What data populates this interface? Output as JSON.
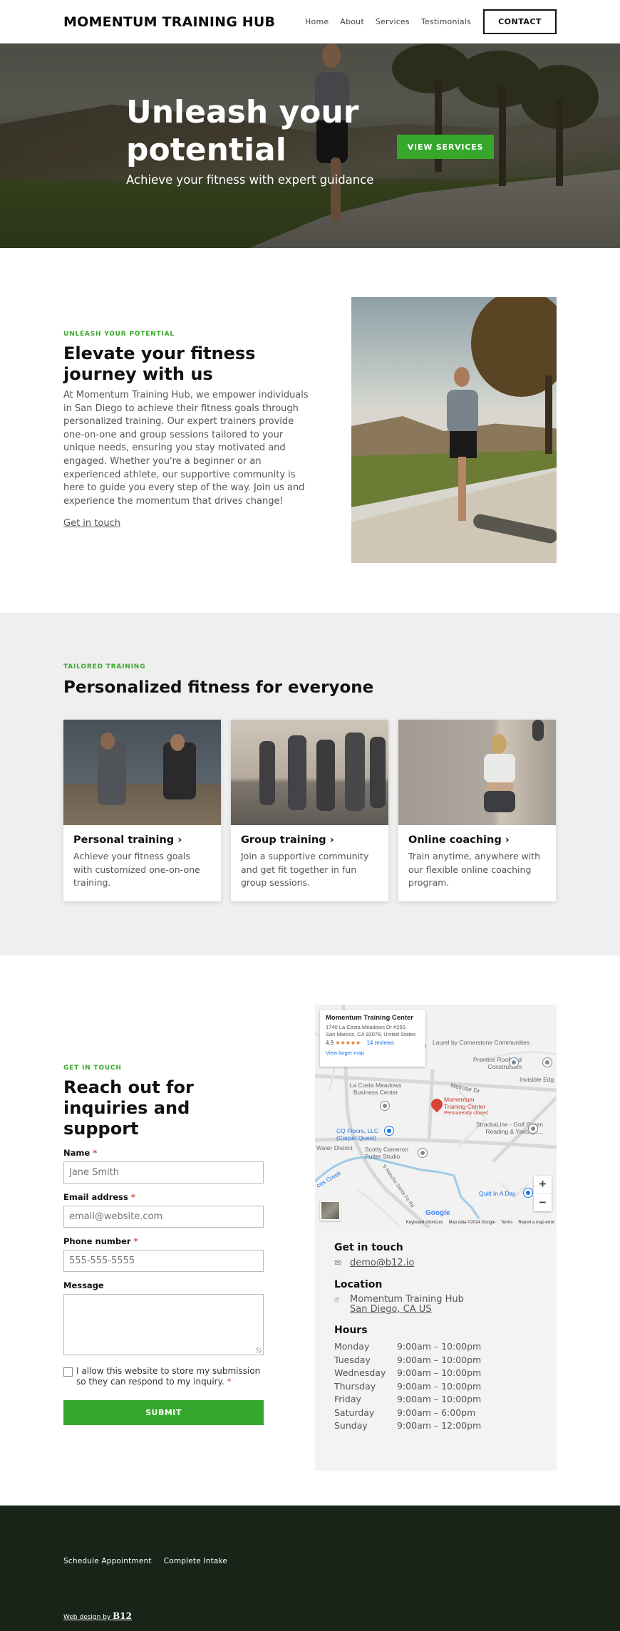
{
  "header": {
    "logo": "MOMENTUM TRAINING HUB",
    "nav": [
      "Home",
      "About",
      "Services",
      "Testimonials"
    ],
    "cta": "CONTACT"
  },
  "hero": {
    "title": "Unleash your potential",
    "subtitle": "Achieve your fitness with expert guidance",
    "button": "VIEW SERVICES"
  },
  "about": {
    "eyebrow": "UNLEASH YOUR POTENTIAL",
    "title": "Elevate your fitness journey with us",
    "body": "At Momentum Training Hub, we empower individuals in San Diego to achieve their fitness goals through personalized training. Our expert trainers provide one-on-one and group sessions tailored to your unique needs, ensuring you stay motivated and engaged. Whether you're a beginner or an experienced athlete, our supportive community is here to guide you every step of the way. Join us and experience the momentum that drives change!",
    "link": "Get in touch",
    "image_alt": "Woman jogging on a path"
  },
  "services": {
    "eyebrow": "TAILORED TRAINING",
    "title": "Personalized fitness for everyone",
    "cards": [
      {
        "title": "Personal training",
        "chevron": "›",
        "desc": "Achieve your fitness goals with customized one-on-one training."
      },
      {
        "title": "Group training",
        "chevron": "›",
        "desc": "Join a supportive community and get fit together in fun group sessions."
      },
      {
        "title": "Online coaching",
        "chevron": "›",
        "desc": "Train anytime, anywhere with our flexible online coaching program."
      }
    ]
  },
  "contact": {
    "eyebrow": "GET IN TOUCH",
    "title": "Reach out for inquiries and support",
    "fields": {
      "name": {
        "label": "Name",
        "required": "*",
        "placeholder": "Jane Smith"
      },
      "email": {
        "label": "Email address",
        "required": "*",
        "placeholder": "email@website.com"
      },
      "phone": {
        "label": "Phone number",
        "required": "*",
        "placeholder": "555-555-5555"
      },
      "message": {
        "label": "Message",
        "value": ""
      }
    },
    "consent": "I allow this website to store my submission so they can respond to my inquiry.",
    "consent_required": "*",
    "submit": "SUBMIT"
  },
  "map": {
    "place_name": "Momentum Training Center",
    "address_line1": "1740 La Costa Meadows Dr #250,",
    "address_line2": "San Marcos, CA 92078, United States",
    "rating": "4.9",
    "stars": "★★★★★",
    "reviews": "14 reviews",
    "larger_map": "View larger map",
    "pin_label_1": "Momentum",
    "pin_label_2": "Training Center",
    "pin_status": "Permanently closed",
    "labels": {
      "laurel": "Laurel by Cornerstone Communities",
      "prentice": "Prentice Roof and Construction",
      "invisible": "Invisible Edg",
      "melrose": "Melrose Dr",
      "lacosta": "La Costa Meadows Business Center",
      "cq": "CQ Floors, LLC (Carpet Quest)",
      "strackaline": "StrackaLine - Golf Green Reading & Yardage...",
      "water": "Water District",
      "scotty": "Scotty Cameron Putter Studio",
      "creek": "cos Creek",
      "rancho": "S Rancho Santa Fe Rd",
      "quilt": "Quilt In A Day"
    },
    "zoom_in": "+",
    "zoom_out": "−",
    "google": "Google",
    "footer": [
      "Keyboard shortcuts",
      "Map data ©2024 Google",
      "Terms",
      "Report a map error"
    ]
  },
  "info": {
    "touch_title": "Get in touch",
    "email": "demo@b12.io",
    "location_title": "Location",
    "location_line1": "Momentum Training Hub",
    "location_line2": "San Diego, CA US",
    "hours_title": "Hours",
    "hours": [
      {
        "day": "Monday",
        "time": "9:00am  –  10:00pm"
      },
      {
        "day": "Tuesday",
        "time": "9:00am  –  10:00pm"
      },
      {
        "day": "Wednesday",
        "time": "9:00am  –  10:00pm"
      },
      {
        "day": "Thursday",
        "time": "9:00am  –  10:00pm"
      },
      {
        "day": "Friday",
        "time": "9:00am  –  10:00pm"
      },
      {
        "day": "Saturday",
        "time": "9:00am  –  6:00pm"
      },
      {
        "day": "Sunday",
        "time": "9:00am  –  12:00pm"
      }
    ]
  },
  "footer": {
    "links": [
      "Schedule Appointment",
      "Complete Intake"
    ],
    "credit_prefix": "Web design by ",
    "credit_brand": "B12"
  },
  "colors": {
    "accent": "#35a82b",
    "footer_bg": "#182418",
    "section_gray": "#eeefee",
    "map_pin": "#d94434",
    "map_link": "#1a73e8"
  }
}
